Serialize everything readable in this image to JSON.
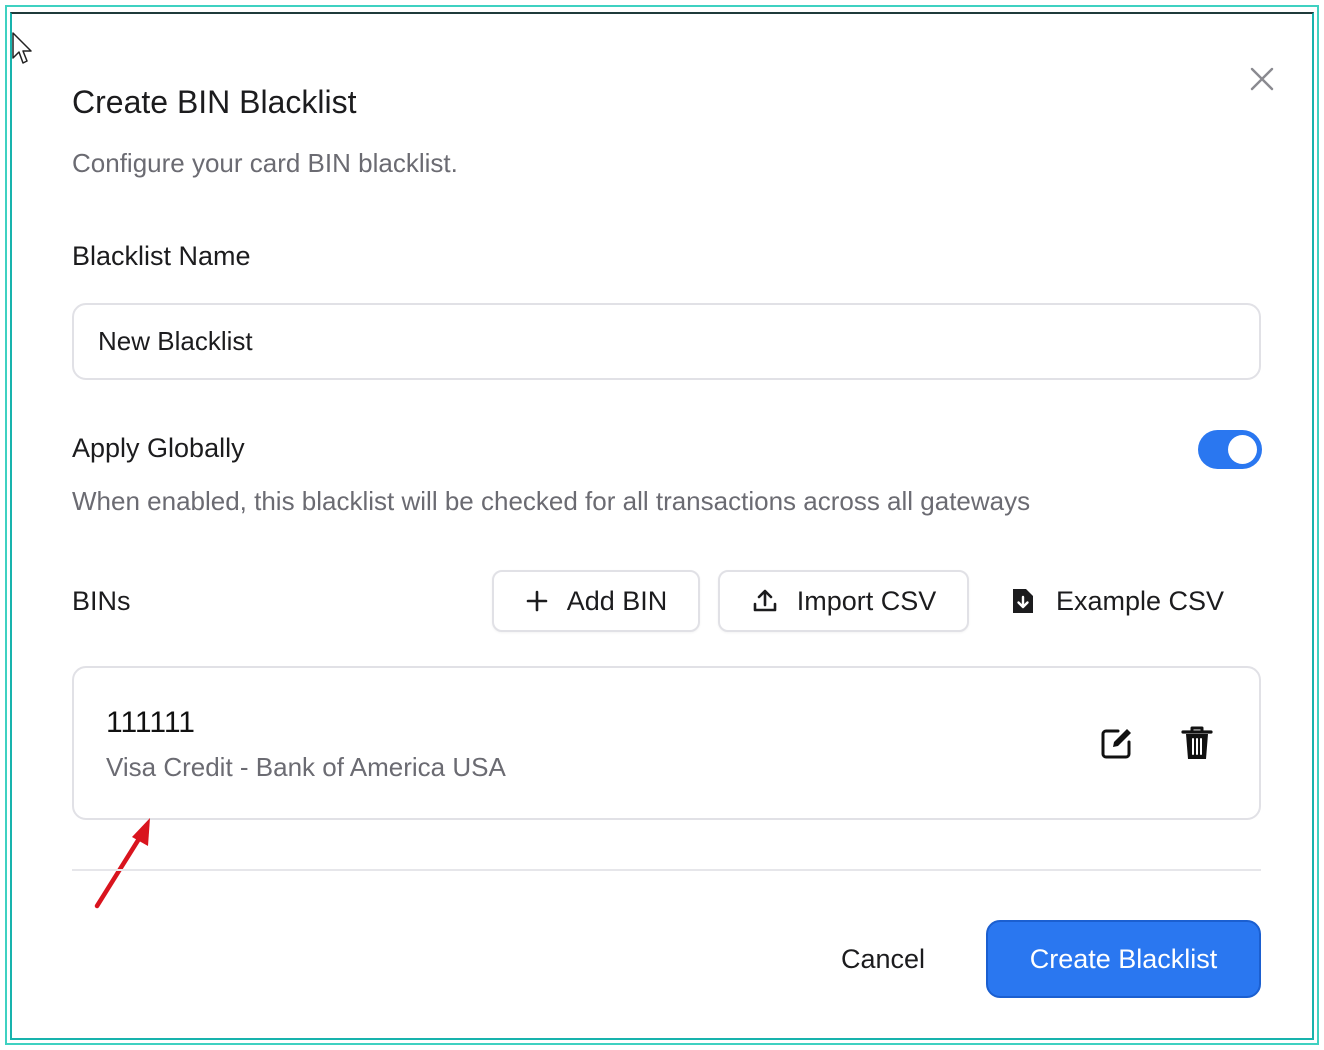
{
  "dialog": {
    "title": "Create BIN Blacklist",
    "subtitle": "Configure your card BIN blacklist."
  },
  "form": {
    "name_label": "Blacklist Name",
    "name_value": "New Blacklist",
    "apply_globally_label": "Apply Globally",
    "apply_globally_enabled": true,
    "apply_globally_help": "When enabled, this blacklist will be checked for all transactions across all gateways"
  },
  "bins": {
    "label": "BINs",
    "add_label": "Add BIN",
    "import_label": "Import CSV",
    "example_label": "Example CSV",
    "items": [
      {
        "number": "111111",
        "description": "Visa Credit - Bank of America USA"
      }
    ]
  },
  "footer": {
    "cancel_label": "Cancel",
    "create_label": "Create Blacklist"
  },
  "colors": {
    "accent": "#2a77f0",
    "annotation_arrow": "#d9141e",
    "frame": "#3fd1c1"
  },
  "icons": [
    "cursor-icon",
    "close-icon",
    "plus-icon",
    "upload-icon",
    "file-download-icon",
    "edit-icon",
    "trash-icon",
    "annotation-arrow-icon"
  ]
}
